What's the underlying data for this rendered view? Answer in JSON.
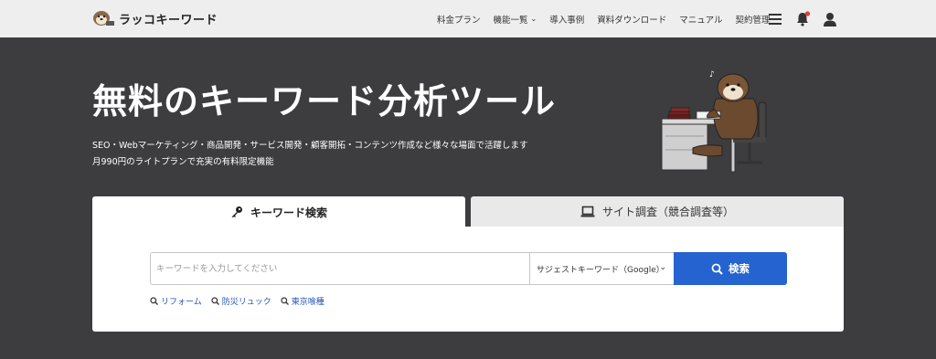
{
  "header": {
    "logo_text": "ラッコキーワード",
    "nav": [
      {
        "label": "料金プラン",
        "chevron": false
      },
      {
        "label": "機能一覧",
        "chevron": true
      },
      {
        "label": "導入事例",
        "chevron": false
      },
      {
        "label": "資料ダウンロード",
        "chevron": false
      },
      {
        "label": "マニュアル",
        "chevron": false
      },
      {
        "label": "契約管理",
        "chevron": false
      }
    ],
    "icons": [
      "hamburger-menu-icon",
      "bell-icon",
      "user-icon"
    ],
    "notification_dot_color": "#e53935"
  },
  "hero": {
    "title": "無料のキーワード分析ツール",
    "subtitle_line1": "SEO・Webマーケティング・商品開発・サービス開発・顧客開拓・コンテンツ作成など様々な場面で活躍します",
    "subtitle_line2": "月990円のライトプランで充実の有料限定機能"
  },
  "tabs": {
    "keyword": {
      "label": "キーワード検索",
      "icon": "key-icon",
      "active": true
    },
    "site": {
      "label": "サイト調査（競合調査等）",
      "icon": "laptop-icon",
      "active": false
    }
  },
  "search": {
    "placeholder": "キーワードを入力してください",
    "value": "",
    "select_value": "サジェストキーワード（Google）",
    "button_label": "検索"
  },
  "suggestions": [
    "リフォーム",
    "防災リュック",
    "東京喰種"
  ],
  "colors": {
    "background": "#3d3d40",
    "header_bg": "#eeeeee",
    "accent": "#2563d0",
    "link": "#1f55b8"
  }
}
